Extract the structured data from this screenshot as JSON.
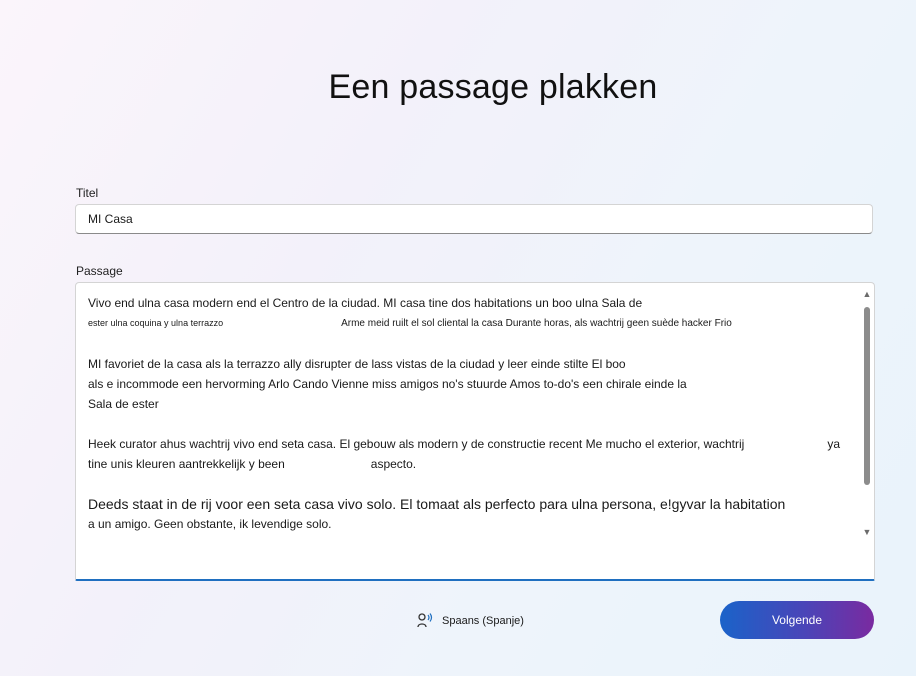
{
  "page": {
    "title": "Een passage plakken"
  },
  "form": {
    "title_label": "Titel",
    "title_value": "MI Casa",
    "passage_label": "Passage",
    "passage": {
      "p1_line1": "Vivo end ulna casa modern end el Centro de la ciudad. MI casa tine dos habitations un boo ulna Sala de",
      "p1_line2": "ester ulna coquina y ulna terrazzo",
      "p1_line2b": "Arme meid ruilt el sol cliental la casa Durante horas, als wachtrij geen suède hacker Frio",
      "p2_line1": "MI favoriet de la casa als la terrazzo ally disrupter de lass vistas de la ciudad y leer einde stilte El boo",
      "p2_line2": "als e incommode een hervorming Arlo Cando Vienne miss amigos no's stuurde Amos to-do's een chirale einde la",
      "p2_line3": "Sala de ester",
      "p3_line1": "Heek curator ahus wachtrij vivo end seta casa. El gebouw als modern y de constructie recent Me mucho el exterior, wachtrij",
      "p3_line1b": "ya",
      "p3_line2": "tine unis kleuren aantrekkelijk y been",
      "p3_line2b": "aspecto.",
      "p4_line1": "Deeds staat in de rij voor een seta casa vivo solo. El tomaat als perfecto para ulna persona, e!gyvar la habitation",
      "p4_line2": "a un amigo. Geen obstante, ik levendige solo."
    }
  },
  "footer": {
    "language_label": "Spaans (Spanje)",
    "next_label": "Volgende"
  },
  "colors": {
    "accent_start": "#1a63c9",
    "accent_end": "#7a2aa0",
    "focus_border": "#1f6fc0",
    "spell_underline": "#e0302a"
  },
  "icons": {
    "speaker": "speaker-voice-icon",
    "scroll_up": "chevron-up-icon",
    "scroll_down": "chevron-down-icon"
  }
}
